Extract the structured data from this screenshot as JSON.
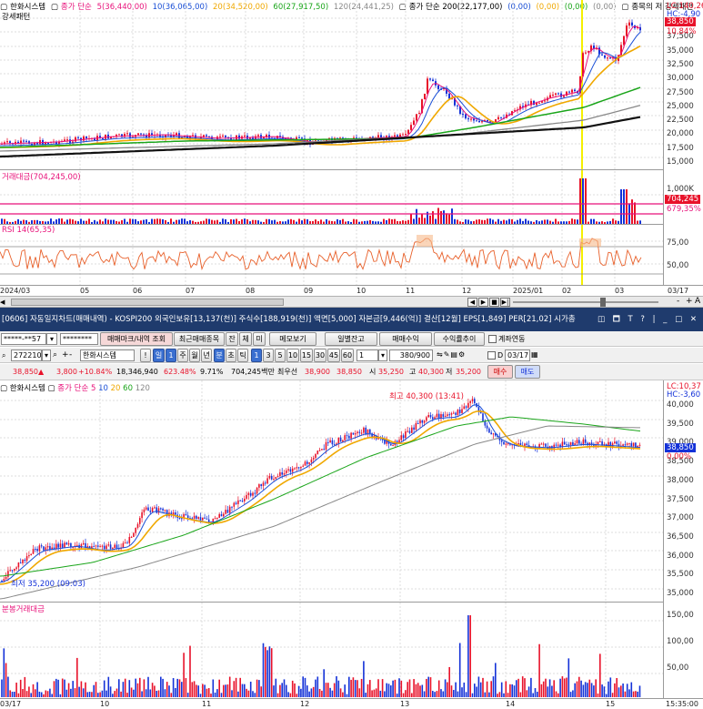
{
  "top_chart": {
    "legend": {
      "title": "한화시스템",
      "price_ma_label": "종가 단순",
      "ma5": "5(36,440,00)",
      "ma10": "10(36,065,00)",
      "ma20": "20(34,520,00)",
      "ma60": "60(27,917,50)",
      "ma120": "120(24,441,25)",
      "ma200_label": "종가 단순 200(22,177,00)",
      "zero1": "(0,00)",
      "zero2": "(0,00)",
      "zero3": "(0,00)",
      "zero4": "(0,00)",
      "indicator": "종목의 저 강세패턴",
      "indicator2": "강세패턴"
    },
    "lc_value": "LC:140,26",
    "hc_value": "HC:-4,90",
    "current_price": "38,850",
    "pct_label": "10,84%",
    "price_axis": [
      "40,000",
      "37,500",
      "35,000",
      "32,500",
      "30,000",
      "27,500",
      "25,000",
      "22,500",
      "20,000",
      "17,500",
      "15,000"
    ],
    "volume_title": "거래대금(704,245,00)",
    "volume_axis_top": "1,000K",
    "volume_value": "704,245",
    "volume_pct": "679,35%",
    "rsi_title": "RSI 14(65,35)",
    "rsi_axis": [
      "75,00",
      "50,00"
    ],
    "x_labels": [
      "2024/03",
      "05",
      "06",
      "07",
      "08",
      "09",
      "10",
      "11",
      "12",
      "2025/01",
      "02",
      "03",
      "03/17"
    ]
  },
  "scrollbar": {
    "buttons": [
      "◀",
      "▶",
      "■",
      "▶|",
      "-",
      "+",
      "A"
    ]
  },
  "window2": {
    "title": "[0606] 자동일지차트(매매내역) - KOSPI200 외국인보유[13,137(천)] 주식수[188,919(천)] 액면[5,000] 자본금[9,446(억)] 결산[12월] EPS[1,849] PER[21,02] 시가총",
    "controls": "◫ 🗖 T ? | _ □ ✕"
  },
  "toolbar1": {
    "account": "*****-**57",
    "password": "********",
    "tab_trade_mark": "매매마크/내역 조회",
    "tab_recent": "최근매매종목",
    "btn_balance": "잔",
    "btn_fill": "체",
    "btn_unfilled": "미",
    "btn_memo": "메모보기",
    "btn_daily_balance": "일별잔고",
    "btn_trade_profit": "매매수익",
    "btn_return_trend": "수익률추이",
    "chk_account_link": "계좌연동"
  },
  "toolbar2": {
    "code": "272210",
    "name": "한화시스템",
    "periods": [
      "일",
      "1",
      "주",
      "월",
      "년",
      "분",
      "초",
      "틱"
    ],
    "intervals": [
      "1",
      "3",
      "5",
      "10",
      "15",
      "30",
      "45",
      "60"
    ],
    "count_select": "1",
    "range": "380/900",
    "date_field": "03/17",
    "chk_d": "D"
  },
  "toolbar3": {
    "price": "38,850",
    "change": "3,800",
    "change_pct": "+10.84%",
    "volume": "18,346,940",
    "vol_pct": "623.48%",
    "turnover": "9.71%",
    "amount": "704,245백만",
    "best_bid_label": "최우선",
    "best_bid": "38,900",
    "best_ask": "38,850",
    "open_label": "시",
    "open": "35,250",
    "high_label": "고",
    "high": "40,300",
    "low_label": "저",
    "low": "35,200",
    "buy_label": "매수",
    "sell_label": "매도"
  },
  "bottom_chart": {
    "legend_title": "한화시스템",
    "legend_ma": "종가 단순",
    "legend_periods": [
      "5",
      "10",
      "20",
      "60",
      "120"
    ],
    "lc_value": "LC:10,37",
    "hc_value": "HC:-3,60",
    "current_price": "38,850",
    "pct": "0,00%",
    "price_axis": [
      "40,000",
      "39,500",
      "39,000",
      "38,500",
      "38,000",
      "37,500",
      "37,000",
      "36,500",
      "36,000",
      "35,500",
      "35,000"
    ],
    "high_note": "최고 40,300 (13:41)",
    "low_note": "최저 35,200 (09:03)",
    "volume_title": "분봉거래대금",
    "volume_axis": [
      "150,00",
      "100,00",
      "50,00"
    ],
    "x_labels": [
      "03/17",
      "10",
      "11",
      "12",
      "13",
      "14",
      "15",
      "15:35:00"
    ]
  },
  "colors": {
    "up": "#e8122a",
    "down": "#1432d8",
    "ma5": "#e8127a",
    "ma10": "#1a4fd6",
    "ma20": "#f0a800",
    "ma60": "#1aa51a",
    "ma120": "#888888",
    "ma200": "#111111",
    "titlebar": "#1f3b6d"
  }
}
